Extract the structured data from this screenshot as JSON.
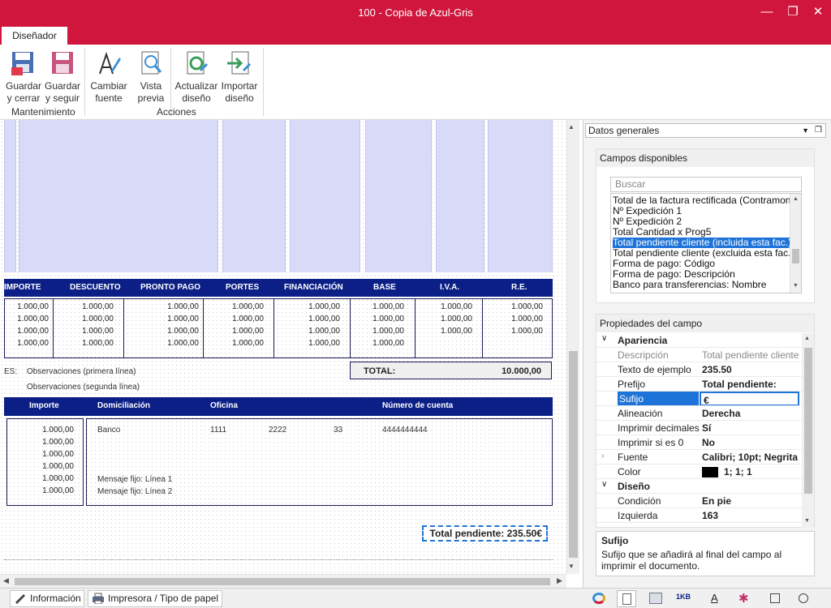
{
  "window": {
    "title": "100 - Copia de Azul-Gris"
  },
  "tabs": [
    {
      "label": "Diseñador"
    }
  ],
  "ribbon": {
    "buttons": [
      {
        "label1": "Guardar",
        "label2": "y cerrar"
      },
      {
        "label1": "Guardar",
        "label2": "y seguir"
      },
      {
        "label1": "Cambiar",
        "label2": "fuente"
      },
      {
        "label1": "Vista",
        "label2": "previa"
      },
      {
        "label1": "Actualizar",
        "label2": "diseño"
      },
      {
        "label1": "Importar",
        "label2": "diseño"
      }
    ],
    "groups": [
      "Mantenimiento",
      "Acciones"
    ]
  },
  "report": {
    "header_cols": [
      "IMPORTE",
      "DESCUENTO",
      "PRONTO PAGO",
      "PORTES",
      "FINANCIACIÓN",
      "BASE",
      "I.V.A.",
      "R.E."
    ],
    "value": "1.000,00",
    "obs_prefix": "ES:",
    "obs1": "Observaciones (primera línea)",
    "obs2": "Observaciones (segunda línea)",
    "total_label": "TOTAL:",
    "total_value": "10.000,00",
    "pay_cols": [
      "Importe",
      "Domiciliación",
      "Oficina",
      "Número de cuenta"
    ],
    "bank": "Banco",
    "office": "1111",
    "branch": "2222",
    "dc": "33",
    "account": "4444444444",
    "fixed1": "Mensaje fijo: Línea 1",
    "fixed2": "Mensaje fijo: Línea 2",
    "pending": "Total pendiente: 235.50€"
  },
  "statusbar": {
    "tabs": [
      "Información",
      "Impresora / Tipo de papel"
    ]
  },
  "panel": {
    "combo": "Datos generales",
    "available_title": "Campos disponibles",
    "search_placeholder": "Buscar",
    "fields": [
      "Total de la factura rectificada  (Contramon",
      "Nº Expedición 1",
      "Nº Expedición 2",
      "Total Cantidad x Prog5",
      "Total pendiente cliente (incluida esta fac.)",
      "Total pendiente cliente (excluida esta fac.)",
      "Forma de pago: Código",
      "Forma de pago: Descripción",
      "Banco para transferencias: Nombre"
    ],
    "props_title": "Propiedades del campo",
    "cat_appearance": "Apariencia",
    "cat_design": "Diseño",
    "props": [
      {
        "name": "Descripción",
        "value": "Total pendiente cliente"
      },
      {
        "name": "Texto de ejemplo",
        "value": "235.50"
      },
      {
        "name": "Prefijo",
        "value": "Total pendiente:"
      },
      {
        "name": "Sufijo",
        "value": "€"
      },
      {
        "name": "Alineación",
        "value": "Derecha"
      },
      {
        "name": "Imprimir decimales",
        "value": "Sí"
      },
      {
        "name": "Imprimir si es 0",
        "value": "No"
      },
      {
        "name": "Fuente",
        "value": "Calibri; 10pt; Negrita"
      },
      {
        "name": "Color",
        "value": "1; 1; 1"
      }
    ],
    "props2": [
      {
        "name": "Condición",
        "value": "En pie"
      },
      {
        "name": "Izquierda",
        "value": "163"
      }
    ],
    "desc_title": "Sufijo",
    "desc_text": "Sufijo que se añadirá al final del campo al imprimir el documento."
  },
  "colors": {
    "accent": "#d0163c",
    "navy": "#0b1f86",
    "selection": "#1e73d8",
    "column_fill": "#d9daf7"
  }
}
